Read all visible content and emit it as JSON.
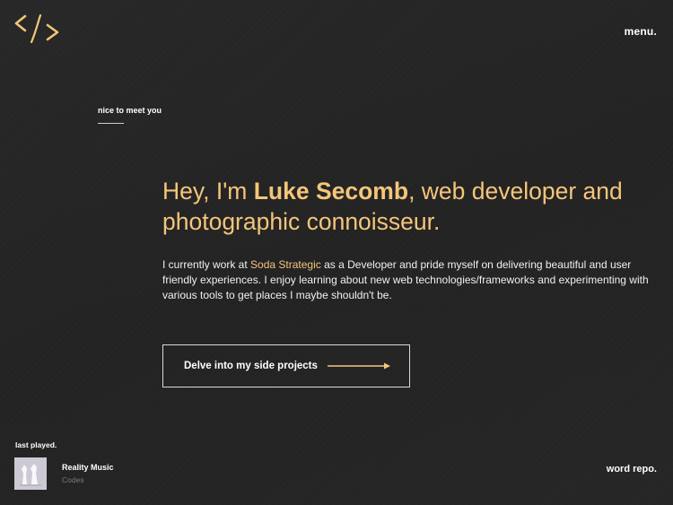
{
  "header": {
    "logo_icon": "code-slash-icon",
    "menu_label": "menu."
  },
  "hero": {
    "eyebrow": "nice to meet you",
    "headline_prefix": "Hey, I'm ",
    "name": "Luke Secomb",
    "headline_suffix": ", web developer and photographic connoisseur.",
    "intro_before": "I currently work at ",
    "company": "Soda Strategic",
    "intro_after": " as a Developer and pride myself on delivering beautiful and user friendly experiences. I enjoy learning about new web technologies/frameworks and experimenting with various tools to get places I maybe shouldn't be.",
    "cta_label": "Delve into my side projects",
    "cta_icon": "arrow-right-icon"
  },
  "footer": {
    "last_played_label": "last played.",
    "track_title": "Reality Music",
    "track_artist": "Codes",
    "word_repo_label": "word repo."
  },
  "colors": {
    "background": "#242424",
    "accent": "#f5c57a",
    "text": "#ffffff",
    "muted": "#7a7a7a"
  }
}
